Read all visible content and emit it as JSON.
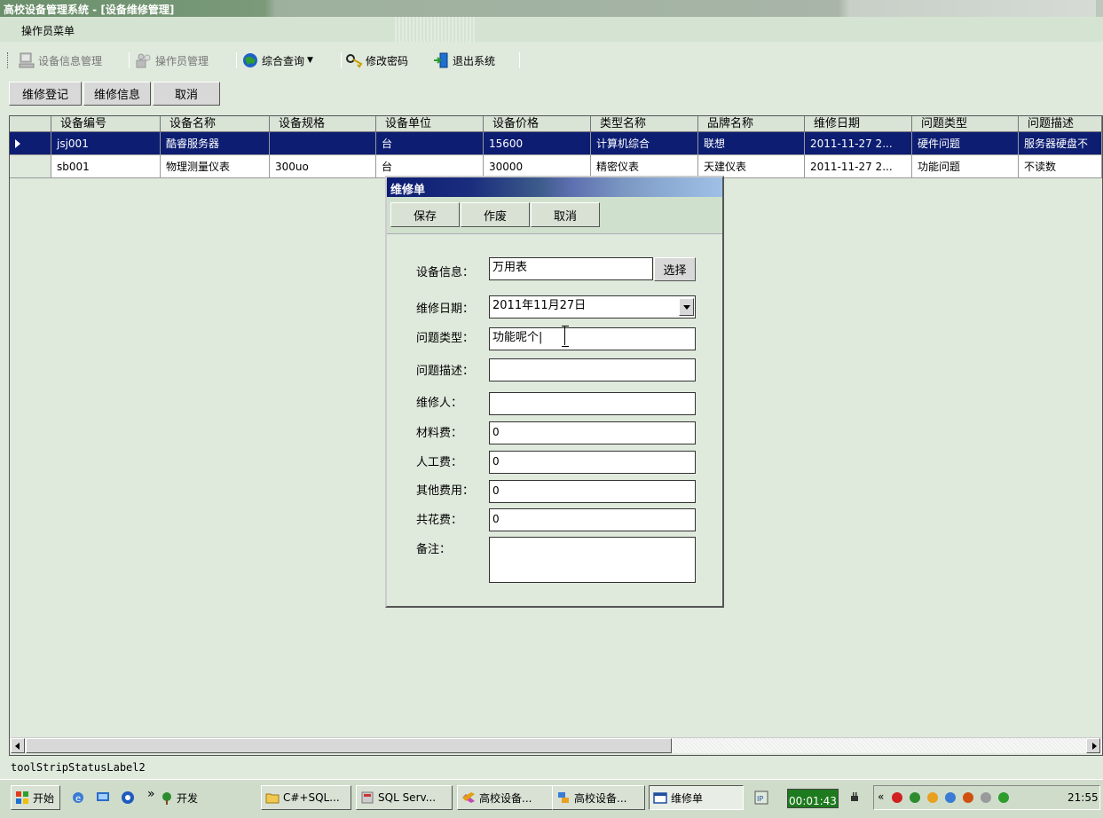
{
  "window": {
    "title": "高校设备管理系统 - [设备维修管理]"
  },
  "menubar": {
    "operator_menu": "操作员菜单"
  },
  "toolbar": {
    "device_info": "设备信息管理",
    "operator_mgmt": "操作员管理",
    "query": "综合查询",
    "change_password": "修改密码",
    "exit": "退出系统"
  },
  "subbar": {
    "register": "维修登记",
    "info": "维修信息",
    "cancel": "取消"
  },
  "grid": {
    "columns": [
      "设备编号",
      "设备名称",
      "设备规格",
      "设备单位",
      "设备价格",
      "类型名称",
      "品牌名称",
      "维修日期",
      "问题类型",
      "问题描述"
    ],
    "rows": [
      {
        "selected": true,
        "cells": [
          "jsj001",
          "酷睿服务器",
          "",
          "台",
          "15600",
          "计算机综合",
          "联想",
          "2011-11-27 2...",
          "硬件问题",
          "服务器硬盘不"
        ]
      },
      {
        "selected": false,
        "cells": [
          "sb001",
          "物理测量仪表",
          "300uo",
          "台",
          "30000",
          "精密仪表",
          "天建仪表",
          "2011-11-27 2...",
          "功能问题",
          "不读数"
        ]
      }
    ]
  },
  "dialog": {
    "title": "维修单",
    "buttons": {
      "save": "保存",
      "void": "作废",
      "cancel": "取消"
    },
    "fields": {
      "device_label": "设备信息：",
      "device_value": "万用表",
      "pick": "选择",
      "date_label": "维修日期：",
      "date_value": "2011年11月27日",
      "problem_type_label": "问题类型：",
      "problem_type_value": "功能呢个|",
      "problem_desc_label": "问题描述：",
      "problem_desc_value": "",
      "repairer_label": "维修人：",
      "repairer_value": "",
      "material_label": "材料费：",
      "material_value": "0",
      "labor_label": "人工费：",
      "labor_value": "0",
      "other_label": "其他费用：",
      "other_value": "0",
      "total_label": "共花费：",
      "total_value": "0",
      "remark_label": "备注：",
      "remark_value": ""
    }
  },
  "status": {
    "label": "toolStripStatusLabel2"
  },
  "taskbar": {
    "start": "开始",
    "dev": "开发",
    "items": [
      "C#+SQL...",
      "SQL Serv...",
      "高校设备...",
      "高校设备...",
      "维修单"
    ],
    "timer": "00:01:43",
    "clock": "21:55"
  },
  "colors": {
    "selection": "#0c1d72",
    "background": "#dfe9dc"
  }
}
